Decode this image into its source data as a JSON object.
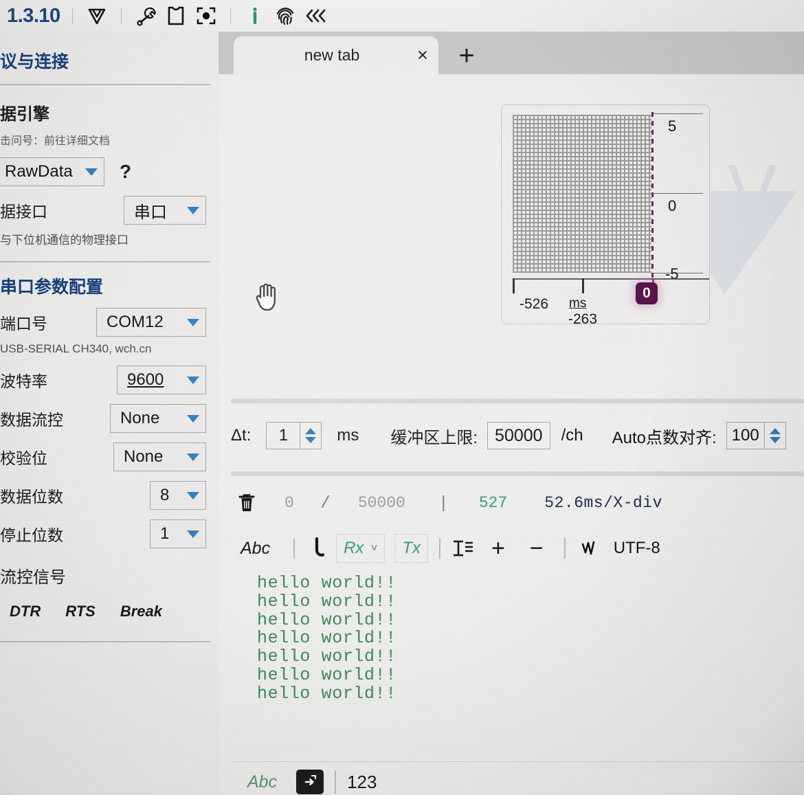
{
  "app": {
    "version": "1.3.10",
    "toolbar_icons": [
      {
        "name": "logo-icon",
        "label": "V"
      },
      {
        "name": "wrench-icon",
        "label": "wrench"
      },
      {
        "name": "theme-shirt-icon",
        "label": "theme"
      },
      {
        "name": "focus-target-icon",
        "label": "focus"
      },
      {
        "name": "info-icon",
        "label": "i"
      },
      {
        "name": "fingerprint-icon",
        "label": "fingerprint"
      },
      {
        "name": "collapse-left-icon",
        "label": "«‹"
      }
    ]
  },
  "tabs": {
    "active_label": "new tab",
    "close_label": "×",
    "add_label": "+"
  },
  "sidebar": {
    "section_title": "议与连接",
    "engine": {
      "group_title": "据引擎",
      "hint": "击问号：前往详细文档",
      "value": "RawData",
      "help_label": "?"
    },
    "interface": {
      "label": "据接口",
      "value": "串口",
      "note": "与下位机通信的物理接口"
    },
    "serial_title": "串口参数配置",
    "fields": [
      {
        "label": "端口号",
        "value": "COM12",
        "note": "USB-SERIAL CH340, wch.cn",
        "underline": false
      },
      {
        "label": "波特率",
        "value": "9600",
        "note": "",
        "underline": true
      },
      {
        "label": "数据流控",
        "value": "None",
        "note": "",
        "underline": false
      },
      {
        "label": "校验位",
        "value": "None",
        "note": "",
        "underline": false
      },
      {
        "label": "数据位数",
        "value": "8",
        "note": "",
        "underline": false
      },
      {
        "label": "停止位数",
        "value": "1",
        "note": "",
        "underline": false
      }
    ],
    "flow_signal_label": "流控信号",
    "flow_signals": [
      "DTR",
      "RTS",
      "Break"
    ]
  },
  "chart_data": {
    "type": "line",
    "title": "",
    "xlabel": "ms",
    "ylabel": "",
    "x_ticks": [
      "-526",
      "-263",
      "0"
    ],
    "y_ticks": [
      "5",
      "0",
      "-5"
    ],
    "xlim": [
      -526,
      0
    ],
    "ylim": [
      -5,
      5
    ],
    "grid": true,
    "grid_cols": 10,
    "grid_rows": 10,
    "series": [],
    "cursor": {
      "label": "0",
      "position": "right",
      "color": "#5b1248"
    },
    "unit_label": "ms",
    "watermark": "VOFA"
  },
  "config_bar": {
    "dt_label": "Δt:",
    "dt_value": "1",
    "dt_unit": "ms",
    "buffer_label": "缓冲区上限:",
    "buffer_value": "50000",
    "buffer_unit": "/ch",
    "align_label": "Auto点数对齐:",
    "align_value": "100"
  },
  "status_bar": {
    "trash_icon": "trash-icon",
    "current": "0",
    "slash": "/",
    "total": "50000",
    "divider": "|",
    "count": "527",
    "timebase": "52.6ms/X-div"
  },
  "term_toolbar": {
    "abc_label": "Abc",
    "phone_icon": "phone-hook-icon",
    "rx_label": "Rx",
    "rx_caret": "˅",
    "tx_label": "Tx",
    "wrap_icon": "text-wrap-icon",
    "plus_label": "+",
    "minus_label": "−",
    "wave_icon": "waveform-icon",
    "encoding": "UTF-8"
  },
  "terminal": {
    "lines": [
      "hello world!!",
      "hello world!!",
      "hello world!!",
      "hello world!!",
      "hello world!!",
      "hello world!!",
      "hello world!!"
    ]
  },
  "send_bar": {
    "abc_label": "Abc",
    "send_icon": "send-file-icon",
    "numeric_label": "123"
  },
  "colors": {
    "accent_blue": "#16407a",
    "caret_blue": "#2b7fc4",
    "terminal_green": "#3d8a5c",
    "cursor_purple": "#5b1248",
    "status_green": "#2f9e77"
  }
}
